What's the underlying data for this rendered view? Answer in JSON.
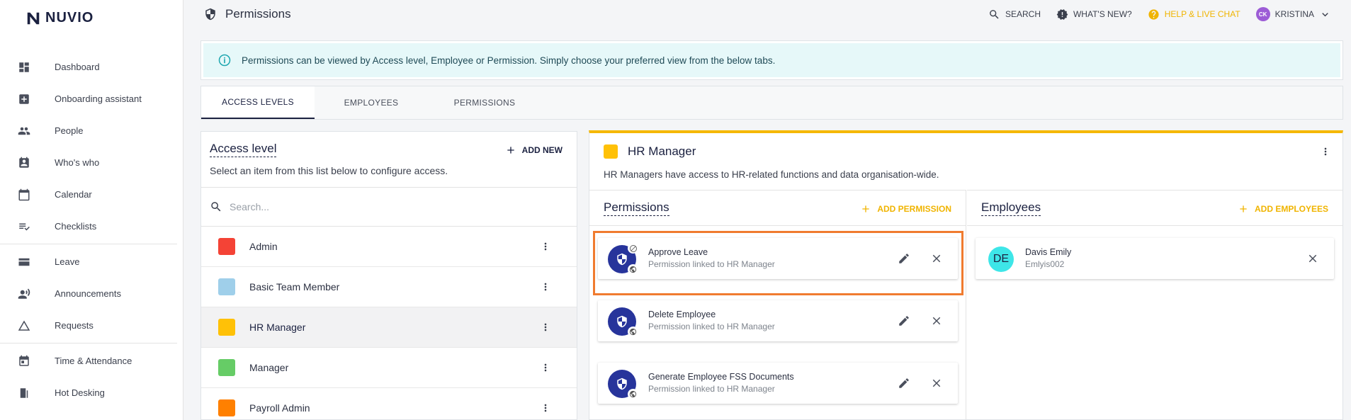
{
  "app": {
    "logo": "NUVIO"
  },
  "sidebar": {
    "items": [
      {
        "label": "Dashboard",
        "icon": "dashboard-icon"
      },
      {
        "label": "Onboarding assistant",
        "icon": "onboarding-icon"
      },
      {
        "label": "People",
        "icon": "people-icon"
      },
      {
        "label": "Who's who",
        "icon": "badge-icon"
      },
      {
        "label": "Calendar",
        "icon": "calendar-icon"
      },
      {
        "label": "Checklists",
        "icon": "checklist-icon"
      },
      {
        "label": "Leave",
        "icon": "leave-icon"
      },
      {
        "label": "Announcements",
        "icon": "announcement-icon"
      },
      {
        "label": "Requests",
        "icon": "requests-icon"
      },
      {
        "label": "Time & Attendance",
        "icon": "time-icon"
      },
      {
        "label": "Hot Desking",
        "icon": "desk-icon"
      }
    ]
  },
  "header": {
    "title": "Permissions",
    "search": "SEARCH",
    "whats_new": "WHAT'S NEW?",
    "help": "HELP & LIVE CHAT",
    "user_initials": "CK",
    "user_name": "KRISTINA"
  },
  "banner": {
    "text": "Permissions can be viewed by Access level, Employee or Permission. Simply choose your preferred view from the below tabs."
  },
  "tabs": [
    {
      "label": "ACCESS LEVELS",
      "active": true
    },
    {
      "label": "EMPLOYEES",
      "active": false
    },
    {
      "label": "PERMISSIONS",
      "active": false
    }
  ],
  "access_level": {
    "title": "Access level",
    "add_label": "ADD NEW",
    "subtitle": "Select an item from this list below to configure access.",
    "search_placeholder": "Search...",
    "items": [
      {
        "label": "Admin",
        "color": "#f44336"
      },
      {
        "label": "Basic Team Member",
        "color": "#9fcfea"
      },
      {
        "label": "HR Manager",
        "color": "#ffc107",
        "selected": true
      },
      {
        "label": "Manager",
        "color": "#66cc66"
      },
      {
        "label": "Payroll Admin",
        "color": "#ff8000"
      }
    ]
  },
  "detail": {
    "title": "HR Manager",
    "color": "#ffc107",
    "description": "HR Managers have access to HR-related functions and data organisation-wide.",
    "permissions": {
      "title": "Permissions",
      "add_label": "ADD PERMISSION",
      "items": [
        {
          "name": "Approve Leave",
          "sub": "Permission linked to HR Manager"
        },
        {
          "name": "Delete Employee",
          "sub": "Permission linked to HR Manager"
        },
        {
          "name": "Generate Employee FSS Documents",
          "sub": "Permission linked to HR Manager"
        }
      ]
    },
    "employees": {
      "title": "Employees",
      "add_label": "ADD EMPLOYEES",
      "items": [
        {
          "initials": "DE",
          "name": "Davis Emily",
          "sub": "Emlyis002"
        }
      ]
    }
  }
}
